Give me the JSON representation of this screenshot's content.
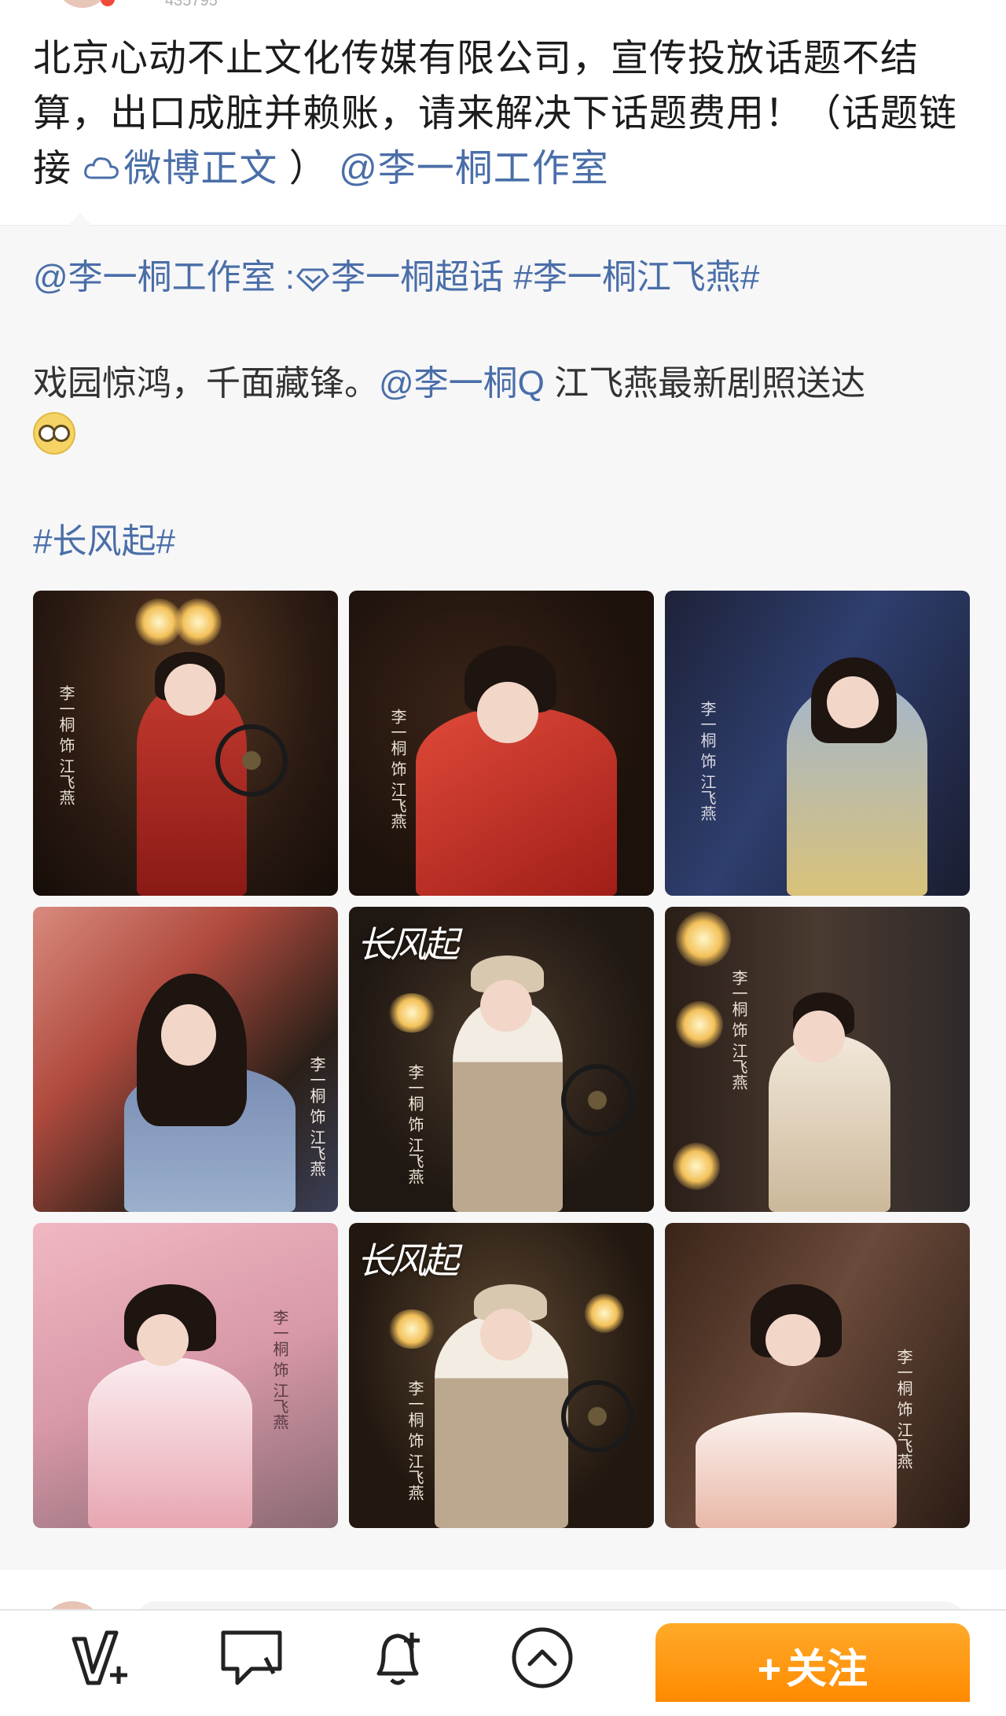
{
  "header": {
    "meta_text": "435795"
  },
  "post": {
    "text": "北京心动不止文化传媒有限公司，宣传投放话题不结算，出口成脏并赖账，请来解决下话题费用！（话题链接",
    "link_label": "微博正文",
    "text_tail": "）",
    "mention": "@李一桐工作室"
  },
  "repost": {
    "mention": "@李一桐工作室",
    "colon": " :",
    "supertopic": "李一桐超话",
    "hashtag1": " #李一桐江飞燕#",
    "body_text": "戏园惊鸿，千面藏锋。",
    "body_mention": "@李一桐Q",
    "body_tail": " 江飞燕最新剧照送达",
    "hashtag2": "#长风起#",
    "photos": [
      {
        "vlabel": "李一桐 饰 江飞燕"
      },
      {
        "vlabel": "李一桐 饰 江飞燕"
      },
      {
        "vlabel": "李一桐 饰 江飞燕"
      },
      {
        "vlabel": "李一桐 饰 江飞燕"
      },
      {
        "vlabel": "李一桐 饰 江飞燕",
        "logo": "长风起"
      },
      {
        "vlabel": "李一桐 饰 江飞燕"
      },
      {
        "vlabel": "李一桐 饰 江飞燕"
      },
      {
        "vlabel": "李一桐 饰 江飞燕",
        "logo": "长风起"
      },
      {
        "vlabel": "李一桐 饰 江飞燕"
      }
    ]
  },
  "toolbar": {
    "icons": [
      "edit-repost-icon",
      "comment-icon",
      "add-notification-icon",
      "scroll-up-icon"
    ],
    "follow_plus": "+",
    "follow_label": "关注"
  },
  "colors": {
    "link": "#4a6ea8",
    "follow": "#ff8a00",
    "repost_bg": "#f7f7f8"
  }
}
